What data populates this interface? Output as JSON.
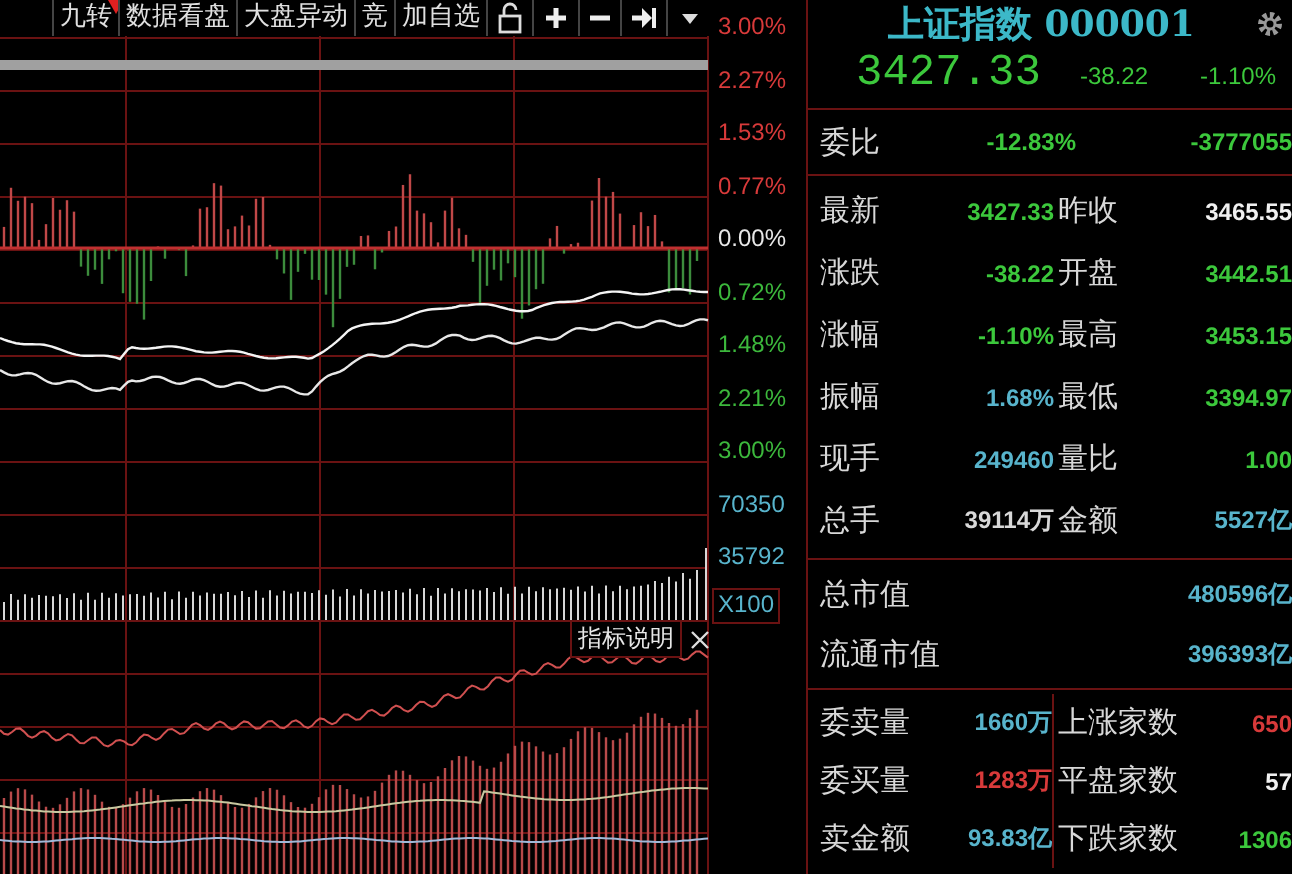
{
  "toolbar": {
    "buttons": [
      {
        "label": "九转",
        "marked": true
      },
      {
        "label": "数据看盘",
        "marked": false
      },
      {
        "label": "大盘异动",
        "marked": false
      },
      {
        "label": "竞",
        "marked": false
      },
      {
        "label": "加自选",
        "marked": false
      }
    ]
  },
  "axis_labels": [
    {
      "text": "3.00%",
      "color": "#d83a3a",
      "kind": "tick"
    },
    {
      "text": "2.27%",
      "color": "#d83a3a",
      "kind": "tick"
    },
    {
      "text": "1.53%",
      "color": "#d83a3a",
      "kind": "tick"
    },
    {
      "text": "0.77%",
      "color": "#d83a3a",
      "kind": "tick"
    },
    {
      "text": "0.00%",
      "color": "#e8e8e8",
      "kind": "tick"
    },
    {
      "text": "0.72%",
      "color": "#3cb83c",
      "kind": "tick"
    },
    {
      "text": "1.48%",
      "color": "#3cb83c",
      "kind": "tick"
    },
    {
      "text": "2.21%",
      "color": "#3cb83c",
      "kind": "tick"
    },
    {
      "text": "3.00%",
      "color": "#3cb83c",
      "kind": "tick"
    },
    {
      "text": "70350",
      "color": "#58b4cc",
      "kind": "tick"
    },
    {
      "text": "35792",
      "color": "#58b4cc",
      "kind": "tick"
    },
    {
      "text": "X100",
      "color": "#58b4cc",
      "kind": "boxed"
    }
  ],
  "indicator_popup": {
    "label": "指标说明"
  },
  "quote": {
    "name": "上证指数",
    "code": "000001",
    "price": "3427.33",
    "change": "-38.22",
    "change_pct": "-1.10%"
  },
  "order_ratio": {
    "label": "委比",
    "percent": "-12.83%",
    "difference": "-3777055"
  },
  "stats": [
    {
      "label": "最新",
      "value": "3427.33",
      "color": "#3cc83c"
    },
    {
      "label": "昨收",
      "value": "3465.55",
      "color": "#f0f0f0"
    },
    {
      "label": "涨跌",
      "value": "-38.22",
      "color": "#3cc83c"
    },
    {
      "label": "开盘",
      "value": "3442.51",
      "color": "#3cc83c"
    },
    {
      "label": "涨幅",
      "value": "-1.10%",
      "color": "#3cc83c"
    },
    {
      "label": "最高",
      "value": "3453.15",
      "color": "#3cc83c"
    },
    {
      "label": "振幅",
      "value": "1.68%",
      "color": "#58b4cc"
    },
    {
      "label": "最低",
      "value": "3394.97",
      "color": "#3cc83c"
    },
    {
      "label": "现手",
      "value": "249460",
      "color": "#58b4cc"
    },
    {
      "label": "量比",
      "value": "1.00",
      "color": "#3cc83c"
    },
    {
      "label": "总手",
      "value": "39114万",
      "color": "#d8d8d8"
    },
    {
      "label": "金额",
      "value": "5527亿",
      "color": "#58b4cc"
    }
  ],
  "market_value": [
    {
      "label": "总市值",
      "value": "480596亿"
    },
    {
      "label": "流通市值",
      "value": "396393亿"
    }
  ],
  "orders": [
    {
      "label": "委卖量",
      "value": "1660万",
      "color": "#58b4cc"
    },
    {
      "label": "上涨家数",
      "value": "650",
      "color": "#d83a3a"
    },
    {
      "label": "委买量",
      "value": "1283万",
      "color": "#d83a3a"
    },
    {
      "label": "平盘家数",
      "value": "57",
      "color": "#f0f0f0"
    },
    {
      "label": "卖金额",
      "value": "93.83亿",
      "color": "#58b4cc"
    },
    {
      "label": "下跌家数",
      "value": "1306",
      "color": "#3cc83c"
    }
  ]
}
